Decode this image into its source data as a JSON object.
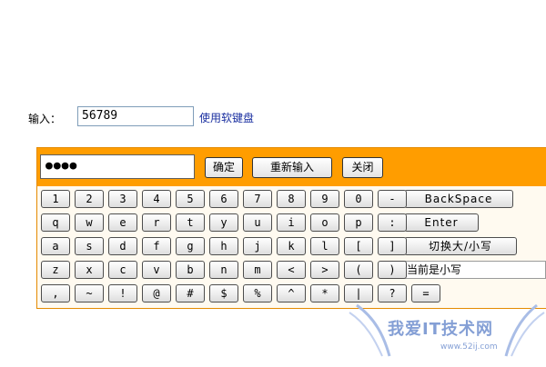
{
  "form": {
    "label": "输入：",
    "value": "56789",
    "keyboard_link": "使用软键盘"
  },
  "keyboard": {
    "password_masked": "●●●●",
    "buttons": {
      "confirm": "确定",
      "reset": "重新输入",
      "close": "关闭"
    },
    "rows": [
      [
        "1",
        "2",
        "3",
        "4",
        "5",
        "6",
        "7",
        "8",
        "9",
        "0",
        "-"
      ],
      [
        "q",
        "w",
        "e",
        "r",
        "t",
        "y",
        "u",
        "i",
        "o",
        "p",
        ":"
      ],
      [
        "a",
        "s",
        "d",
        "f",
        "g",
        "h",
        "j",
        "k",
        "l",
        "[",
        "]"
      ],
      [
        "z",
        "x",
        "c",
        "v",
        "b",
        "n",
        "m",
        "<",
        ">",
        "(",
        ")"
      ],
      [
        ",",
        "~",
        "!",
        "@",
        "#",
        "$",
        "%",
        "^",
        "*",
        "|",
        "?",
        "="
      ]
    ],
    "special": {
      "backspace": "BackSpace",
      "enter": "Enter",
      "switch_case": "切换大/小写"
    },
    "status": "当前是小写"
  },
  "watermark": {
    "text": "我爱IT技术网",
    "url": "www.52ij.com"
  },
  "colors": {
    "header": "#ff9d00",
    "border": "#e48a00",
    "link": "#1a2fa0"
  }
}
